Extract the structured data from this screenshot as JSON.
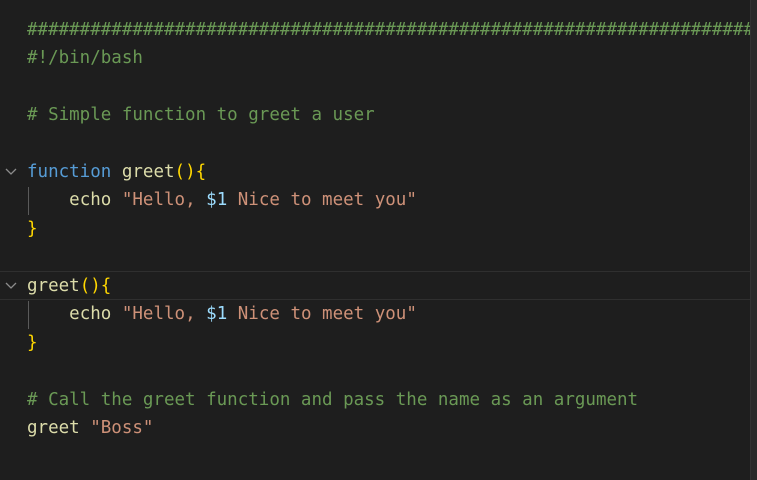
{
  "editor": {
    "lines": {
      "hash_banner": "########################################################################################################",
      "shebang": "#!/bin/bash",
      "comment1": "# Simple function to greet a user",
      "fn1": {
        "keyword": "function",
        "name": "greet",
        "brace_open": "(){",
        "echo_cmd": "echo",
        "str_start": "\"Hello, ",
        "arg": "$1",
        "str_end": " Nice to meet you\"",
        "brace_close": "}"
      },
      "fn2": {
        "name": "greet",
        "brace_open": "(){",
        "echo_cmd": "echo",
        "str_start": "\"Hello, ",
        "arg": "$1",
        "str_end": " Nice to meet you\"",
        "brace_close": "}"
      },
      "comment2": "# Call the greet function and pass the name as an argument",
      "call": {
        "cmd": "greet",
        "arg": "\"Boss\""
      }
    },
    "fold_icons": [
      "chevron-down-icon",
      "chevron-down-icon"
    ]
  }
}
